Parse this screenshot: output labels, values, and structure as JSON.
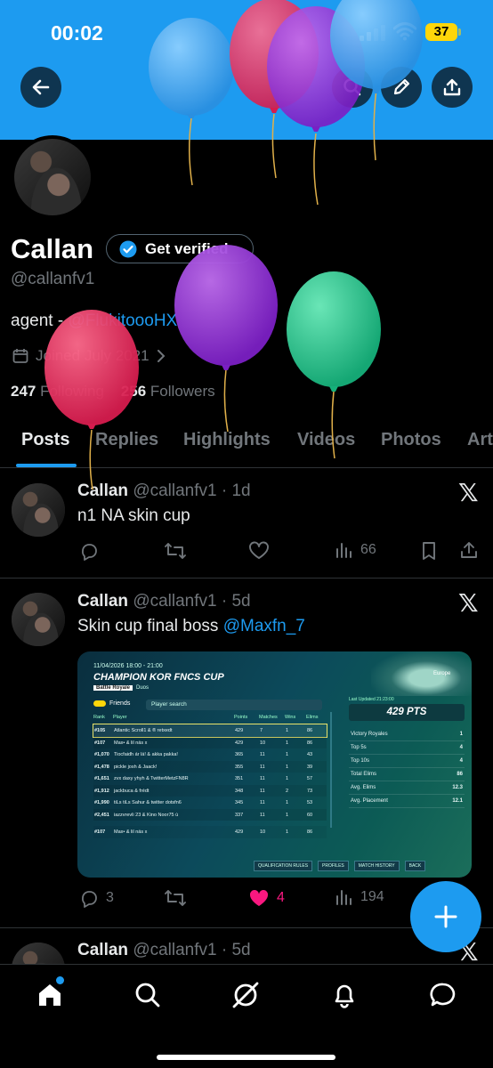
{
  "status_bar": {
    "time": "00:02",
    "battery": "37"
  },
  "header": {
    "back_icon": "arrow-left-icon",
    "search_icon": "search-icon",
    "edit_icon": "pencil-icon",
    "share_icon": "share-icon"
  },
  "profile": {
    "name": "Callan",
    "verify_label": "Get verified",
    "handle": "@callanfv1",
    "bio_text": "agent - ",
    "bio_mention": "@FlukitoooHX",
    "joined": "Joined July 2021",
    "following_count": "247",
    "following_label": " Following",
    "followers_count": "256",
    "followers_label": " Followers"
  },
  "tabs": [
    {
      "label": "Posts",
      "active": true
    },
    {
      "label": "Replies"
    },
    {
      "label": "Highlights"
    },
    {
      "label": "Videos"
    },
    {
      "label": "Photos"
    },
    {
      "label": "Art"
    }
  ],
  "posts": [
    {
      "name": "Callan",
      "meta": "@callanfv1 · 1d",
      "text": "n1 NA skin cup",
      "views": "66"
    },
    {
      "name": "Callan",
      "meta": "@callanfv1 · 5d",
      "text": "Skin cup final boss ",
      "mention": "@Maxfn_7",
      "replies": "3",
      "likes": "4",
      "views": "194"
    },
    {
      "name": "Callan",
      "meta": "@callanfv1 · 5d"
    }
  ],
  "media": {
    "date": "11/04/2026 18:00 - 21:00",
    "title": "CHAMPION KOR FNCS CUP",
    "mode": "Battle Royale",
    "mode_sub": "Duos",
    "friends_label": "Friends",
    "search_placeholder": "Player search",
    "columns": [
      "Rank",
      "Player",
      "Points",
      "Matches",
      "Wins",
      "Elims"
    ],
    "rows": [
      [
        "#105",
        "Atlantic Scroll1 & ® retxedt",
        "429",
        "7",
        "1",
        "86"
      ],
      [
        "#107",
        "Max• & lil nás x",
        "429",
        "10",
        "1",
        "86"
      ],
      [
        "#1,070",
        "Tiocfaidh ár lá! & akka pakka!",
        "365",
        "11",
        "1",
        "43"
      ],
      [
        "#1,478",
        "pickle josh & Jaack!",
        "355",
        "11",
        "1",
        "39"
      ],
      [
        "#1,651",
        "zvx daxy yhyh & TwitterMetzFN8R",
        "351",
        "11",
        "1",
        "57"
      ],
      [
        "#1,912",
        "jackbuca & frédt",
        "348",
        "11",
        "2",
        "73"
      ],
      [
        "#1,990",
        "tiLs tiLs Sahur & twitter dotsfn6",
        "345",
        "11",
        "1",
        "53"
      ],
      [
        "#2,451",
        "iazzvrevli 23 & Kino Noor75 ù",
        "337",
        "11",
        "1",
        "60"
      ],
      [
        "#107",
        "Max• & lil nás x",
        "429",
        "10",
        "1",
        "86"
      ]
    ],
    "region": "Europe",
    "last_updated": "Last Updated 21:23:00",
    "pts": "429 PTS",
    "stats": [
      [
        "Victory Royales",
        "1"
      ],
      [
        "Top 5s",
        "4"
      ],
      [
        "Top 10s",
        "4"
      ],
      [
        "Total Elims",
        "86"
      ],
      [
        "Avg. Elims",
        "12.3"
      ],
      [
        "Avg. Placement",
        "12.1"
      ]
    ],
    "buttons": [
      "QUALIFICATION RULES",
      "PROFILES",
      "MATCH HISTORY",
      "BACK"
    ]
  },
  "colors": {
    "accent": "#1d9bf0",
    "like": "#f91880",
    "muted": "#71767b",
    "banner": "#1d9bf0"
  },
  "nav": [
    "home-icon",
    "search-icon",
    "grok-icon",
    "notifications-icon",
    "messages-icon"
  ]
}
